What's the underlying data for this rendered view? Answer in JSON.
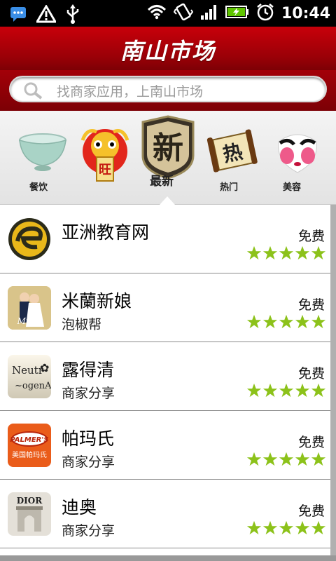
{
  "status_bar": {
    "time": "10:44",
    "icons_left": [
      "message-icon",
      "warning-icon",
      "usb-icon"
    ],
    "icons_right": [
      "wifi-icon",
      "vibrate-icon",
      "signal-icon",
      "battery-charging-icon",
      "alarm-icon"
    ]
  },
  "header": {
    "title": "南山市场"
  },
  "search": {
    "placeholder": "找商家应用，上南山市场"
  },
  "categories": [
    {
      "label": "餐饮",
      "icon": "bowl-icon"
    },
    {
      "label": "旺",
      "icon": "lion-dance-icon"
    },
    {
      "label": "最新",
      "icon": "new-badge-icon",
      "badge_text": "新",
      "selected": true
    },
    {
      "label": "热门",
      "icon": "scroll-icon",
      "badge_text": "热"
    },
    {
      "label": "美容",
      "icon": "opera-mask-icon"
    }
  ],
  "apps": [
    {
      "name": "亚洲教育网",
      "subtitle": "",
      "price": "免费",
      "rating": 5,
      "icon": "asia-edu-logo-icon"
    },
    {
      "name": "米蘭新娘",
      "subtitle": "泡椒帮",
      "price": "免费",
      "rating": 5,
      "icon": "milan-bride-icon",
      "icon_text": "Milan"
    },
    {
      "name": "露得清",
      "subtitle": "商家分享",
      "price": "免费",
      "rating": 5,
      "icon": "neutrogena-icon",
      "icon_text": "Neutr ~ogenA"
    },
    {
      "name": "帕玛氏",
      "subtitle": "商家分享",
      "price": "免费",
      "rating": 5,
      "icon": "palmers-icon",
      "icon_text": "PALMER'S",
      "icon_sub": "美国帕玛氏"
    },
    {
      "name": "迪奥",
      "subtitle": "商家分享",
      "price": "免费",
      "rating": 5,
      "icon": "dior-icon",
      "icon_text": "DIOR"
    }
  ],
  "colors": {
    "header_red": "#b30008",
    "star_green": "#8cc21a"
  }
}
